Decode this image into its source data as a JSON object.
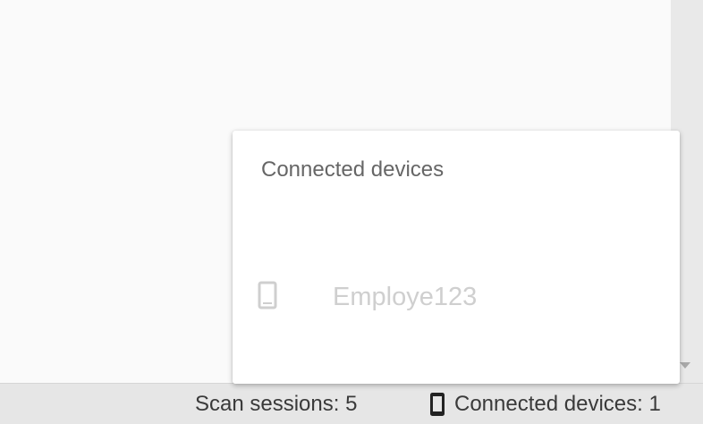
{
  "statusbar": {
    "scan_sessions": "Scan sessions: 5",
    "connected_devices": "Connected devices: 1"
  },
  "popup": {
    "title": "Connected devices",
    "devices": [
      {
        "name": "Employe123",
        "icon": "phone-icon"
      }
    ]
  },
  "icons": {
    "status_device_icon": "phone-icon",
    "scroll_down_icon": "triangle-down-icon"
  },
  "colors": {
    "background": "#fafafa",
    "statusbar": "#e6e6e6",
    "popup": "#ffffff",
    "popup_title": "#666666",
    "device_text_disabled": "#cfcfcf",
    "status_text": "#3a3a3a"
  }
}
